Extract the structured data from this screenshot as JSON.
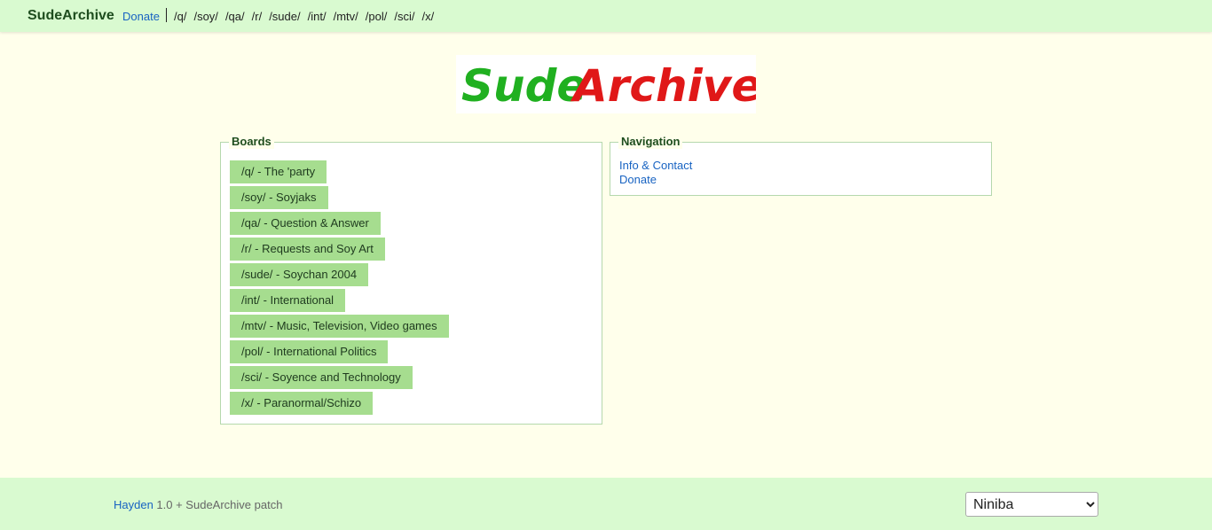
{
  "topbar": {
    "brand": "SudeArchive",
    "donate_label": "Donate",
    "board_links": [
      "/q/",
      "/soy/",
      "/qa/",
      "/r/",
      "/sude/",
      "/int/",
      "/mtv/",
      "/pol/",
      "/sci/",
      "/x/"
    ]
  },
  "logo": {
    "part1": "Sude",
    "part2": "Archive",
    "color1": "#20b020",
    "color2": "#e01818"
  },
  "boards": {
    "legend": "Boards",
    "items": [
      "/q/ - The 'party",
      "/soy/ - Soyjaks",
      "/qa/ - Question & Answer",
      "/r/ - Requests and Soy Art",
      "/sude/ - Soychan 2004",
      "/int/ - International",
      "/mtv/ - Music, Television, Video games",
      "/pol/ - International Politics",
      "/sci/ - Soyence and Technology",
      "/x/ - Paranormal/Schizo"
    ]
  },
  "navigation": {
    "legend": "Navigation",
    "items": [
      "Info & Contact",
      "Donate"
    ]
  },
  "footer": {
    "credit_link": "Hayden",
    "credit_text": " 1.0 + SudeArchive patch",
    "theme_selected": "Niniba"
  },
  "colors": {
    "bar_bg": "#d9fad0",
    "page_bg": "#ffffeb",
    "board_button": "#a6dd8f",
    "link": "#1863c2"
  }
}
